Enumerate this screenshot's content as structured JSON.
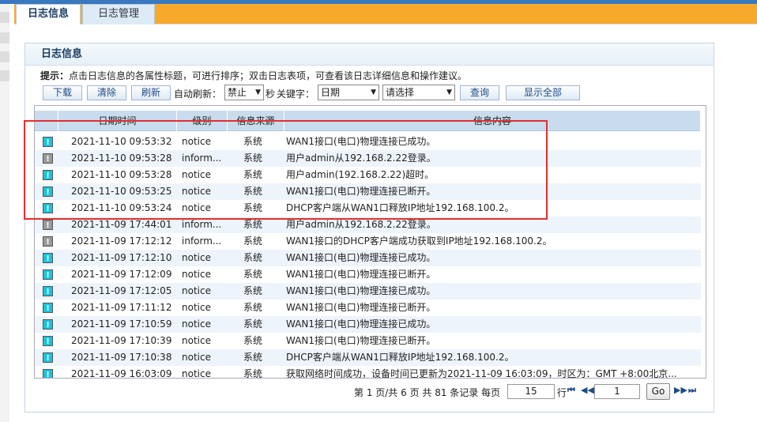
{
  "tabs": [
    {
      "label": "日志信息"
    },
    {
      "label": "日志管理"
    }
  ],
  "panel": {
    "title": "日志信息"
  },
  "hint": {
    "prefix": "提示：",
    "text": "点击日志信息的各属性标题，可进行排序；双击日志表项，可查看该日志详细信息和操作建议。"
  },
  "toolbar": {
    "download": "下载",
    "clear": "清除",
    "refresh": "刷新",
    "auto_refresh_label": "自动刷新：",
    "auto_refresh_value": "禁止",
    "seconds_label": "秒",
    "keyword_label": "关键字：",
    "keyword_field": "日期",
    "keyword_value": "请选择",
    "query": "查询",
    "show_all": "显示全部"
  },
  "table": {
    "headers": [
      "",
      "日期时间",
      "级别",
      "信息来源",
      "信息内容"
    ],
    "rows": [
      {
        "level_icon": "notice",
        "datetime": "2021-11-10 09:53:32",
        "level": "notice",
        "source": "系统",
        "content": "WAN1接口(电口)物理连接已成功。"
      },
      {
        "level_icon": "info",
        "datetime": "2021-11-10 09:53:28",
        "level": "inform...",
        "source": "系统",
        "content": "用户admin从192.168.2.22登录。"
      },
      {
        "level_icon": "notice",
        "datetime": "2021-11-10 09:53:28",
        "level": "notice",
        "source": "系统",
        "content": "用户admin(192.168.2.22)超时。"
      },
      {
        "level_icon": "notice",
        "datetime": "2021-11-10 09:53:25",
        "level": "notice",
        "source": "系统",
        "content": "WAN1接口(电口)物理连接已断开。"
      },
      {
        "level_icon": "notice",
        "datetime": "2021-11-10 09:53:24",
        "level": "notice",
        "source": "系统",
        "content": "DHCP客户端从WAN1口释放IP地址192.168.100.2。"
      },
      {
        "level_icon": "info",
        "datetime": "2021-11-09 17:44:01",
        "level": "inform...",
        "source": "系统",
        "content": "用户admin从192.168.2.22登录。"
      },
      {
        "level_icon": "info",
        "datetime": "2021-11-09 17:12:12",
        "level": "inform...",
        "source": "系统",
        "content": "WAN1接口的DHCP客户端成功获取到IP地址192.168.100.2。"
      },
      {
        "level_icon": "notice",
        "datetime": "2021-11-09 17:12:10",
        "level": "notice",
        "source": "系统",
        "content": "WAN1接口(电口)物理连接已成功。"
      },
      {
        "level_icon": "notice",
        "datetime": "2021-11-09 17:12:09",
        "level": "notice",
        "source": "系统",
        "content": "WAN1接口(电口)物理连接已断开。"
      },
      {
        "level_icon": "notice",
        "datetime": "2021-11-09 17:12:05",
        "level": "notice",
        "source": "系统",
        "content": "WAN1接口(电口)物理连接已成功。"
      },
      {
        "level_icon": "notice",
        "datetime": "2021-11-09 17:11:12",
        "level": "notice",
        "source": "系统",
        "content": "WAN1接口(电口)物理连接已断开。"
      },
      {
        "level_icon": "notice",
        "datetime": "2021-11-09 17:10:59",
        "level": "notice",
        "source": "系统",
        "content": "WAN1接口(电口)物理连接已成功。"
      },
      {
        "level_icon": "notice",
        "datetime": "2021-11-09 17:10:39",
        "level": "notice",
        "source": "系统",
        "content": "WAN1接口(电口)物理连接已断开。"
      },
      {
        "level_icon": "notice",
        "datetime": "2021-11-09 17:10:38",
        "level": "notice",
        "source": "系统",
        "content": "DHCP客户端从WAN1口释放IP地址192.168.100.2。"
      },
      {
        "level_icon": "notice",
        "datetime": "2021-11-09 16:03:09",
        "level": "notice",
        "source": "系统",
        "content": "获取网络时间成功，设备时间已更新为2021-11-09 16:03:09，时区为：GMT +8:00北京..."
      }
    ]
  },
  "pager": {
    "page_info": "第 1 页/共 6 页 共 81 条记录 每页",
    "per_page": "15",
    "rows_label": "行",
    "page_input": "1",
    "go": "Go"
  },
  "colors": {
    "tabbar": "#f7a92c",
    "header_row": "#c9dced",
    "highlight_box": "#e03030",
    "notice_icon": "#17c4e0",
    "info_icon": "#9a9a9a"
  }
}
